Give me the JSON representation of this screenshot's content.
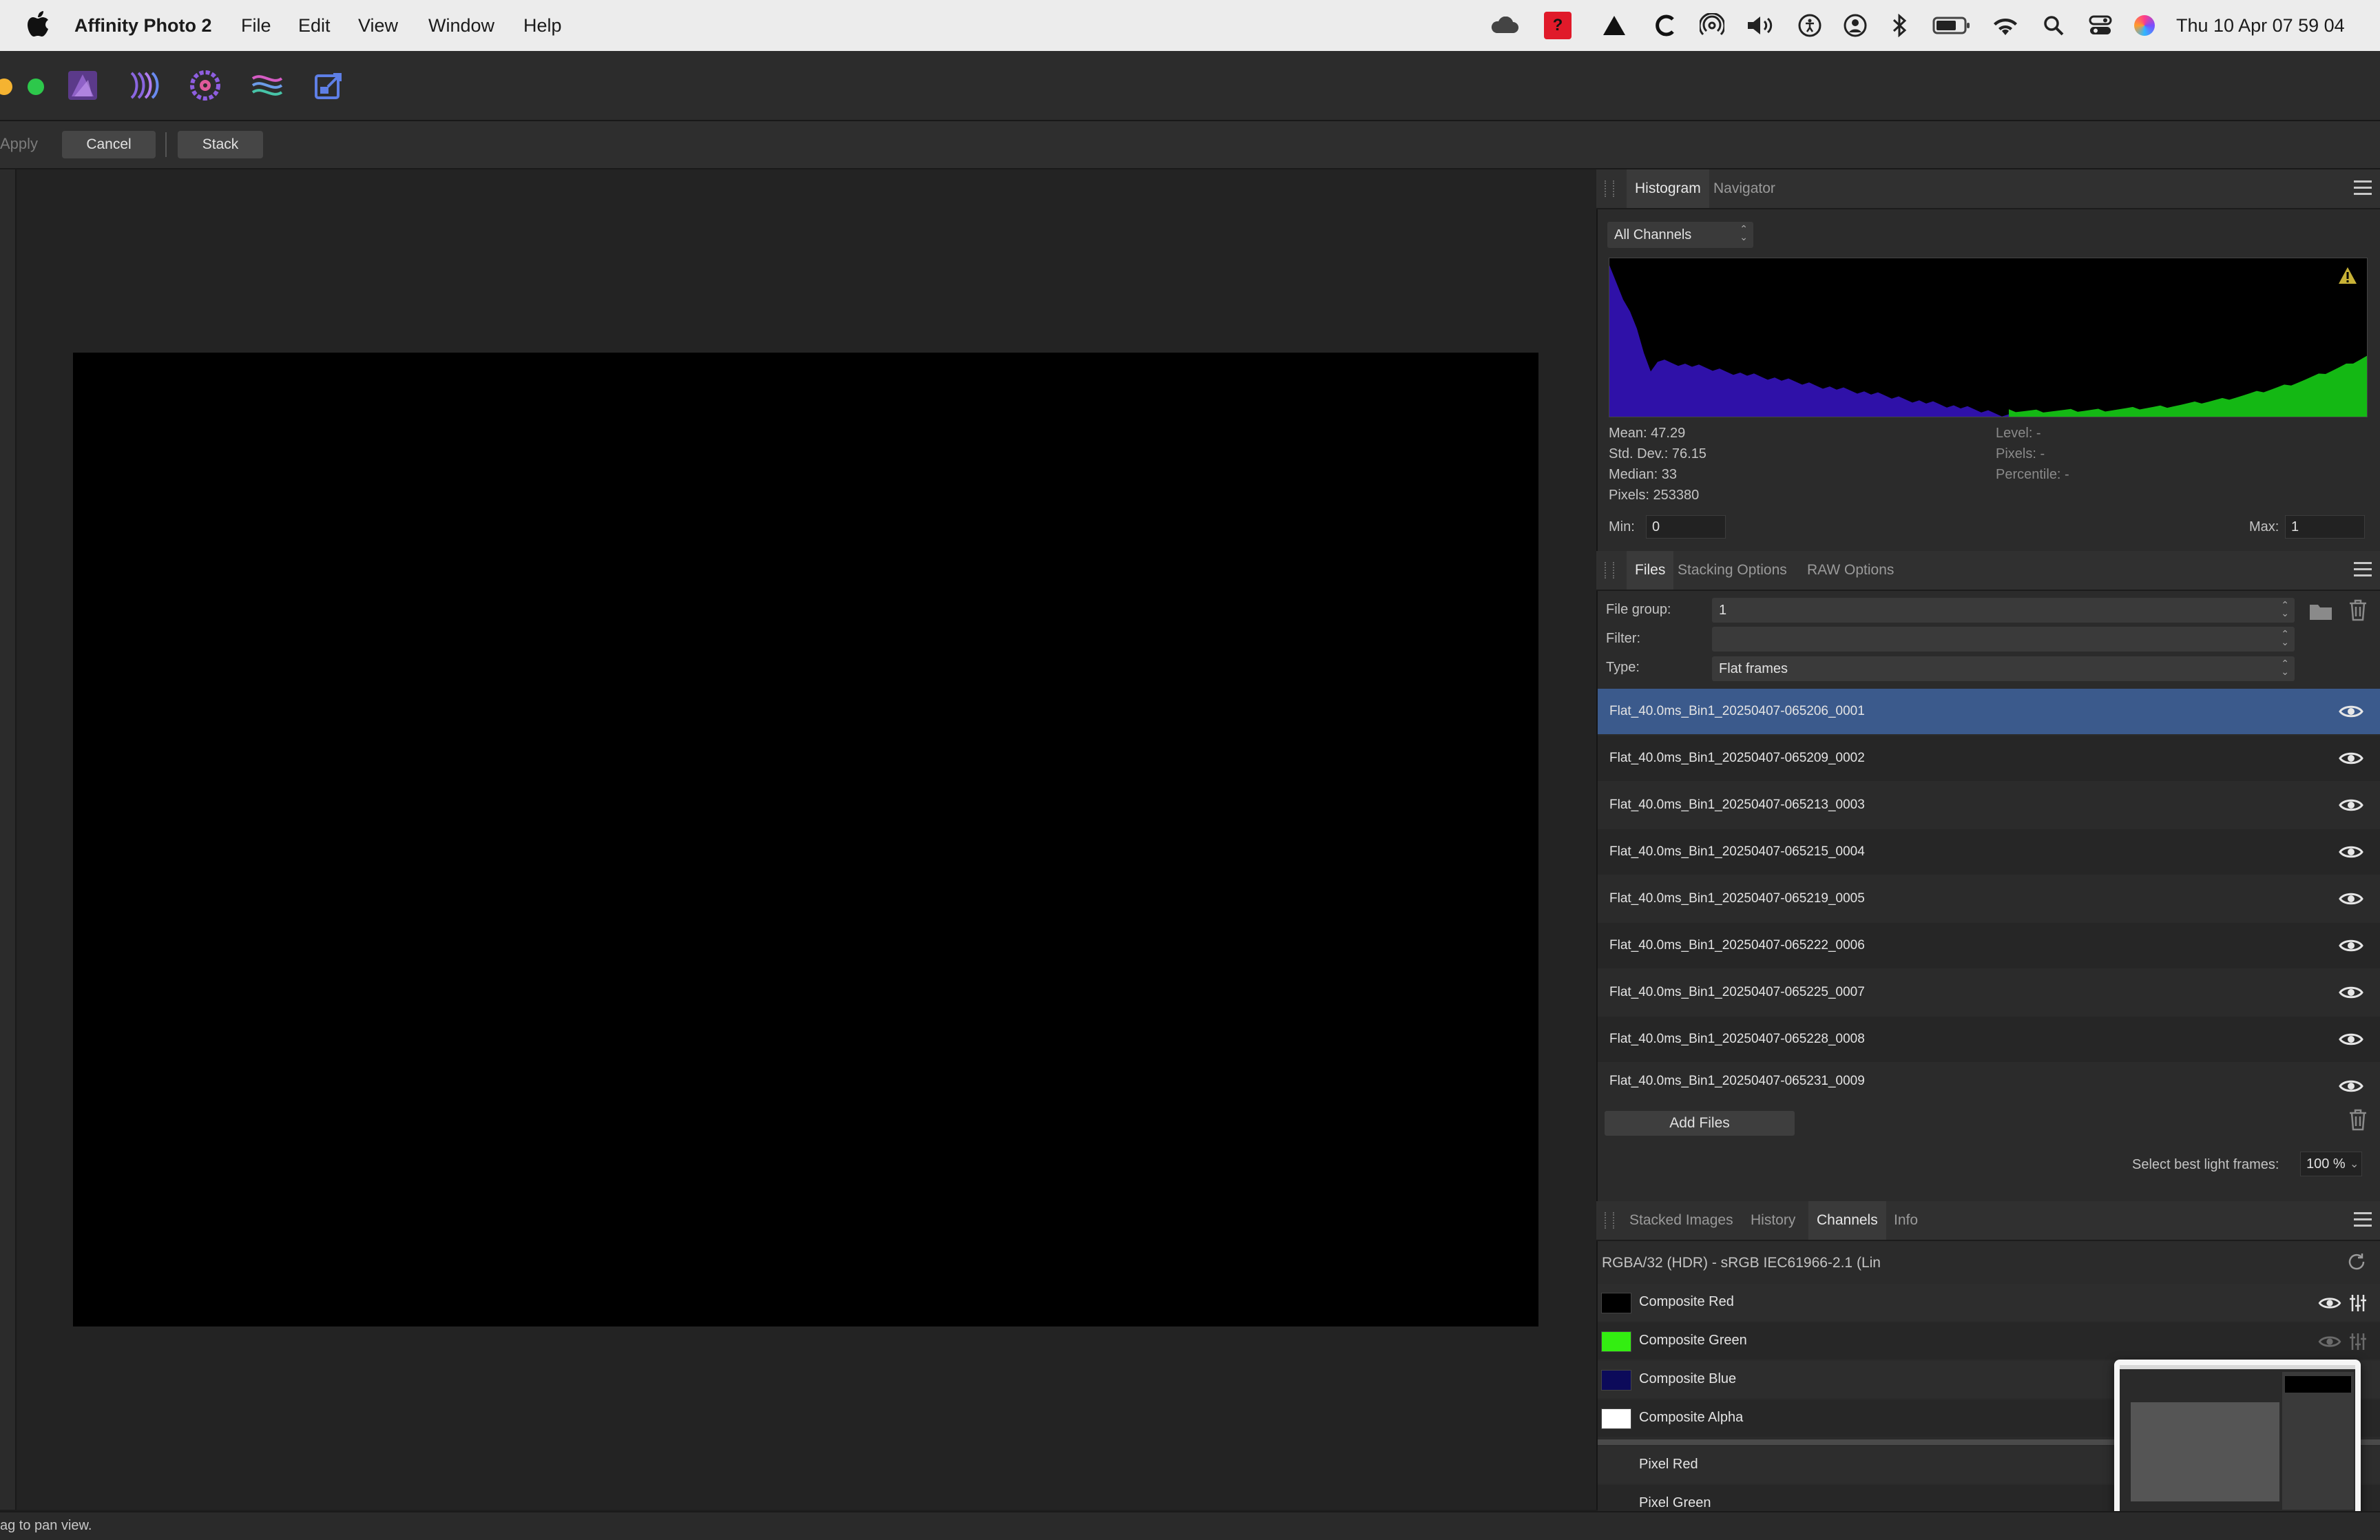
{
  "menubar": {
    "app_name": "Affinity Photo 2",
    "menus": [
      "File",
      "Edit",
      "View",
      "Window",
      "Help"
    ],
    "tray_icons": [
      "cloud-icon",
      "app-red-icon",
      "delta-icon",
      "c-icon",
      "airdrop-icon",
      "volume-icon",
      "accessibility-icon",
      "user-icon",
      "bluetooth-icon",
      "battery-icon",
      "wifi-icon",
      "spotlight-icon",
      "control-center-icon",
      "siri-icon"
    ],
    "clock": "Thu 10 Apr  07 59 04"
  },
  "toolbar": {
    "personas": [
      "photo-persona-icon",
      "liquify-persona-icon",
      "develop-persona-icon",
      "tone-mapping-persona-icon",
      "export-persona-icon"
    ]
  },
  "context_bar": {
    "apply_label": "Apply",
    "cancel_label": "Cancel",
    "stack_label": "Stack"
  },
  "status": {
    "text": "ag to pan view."
  },
  "histogram_panel": {
    "tabs": [
      "Histogram",
      "Navigator"
    ],
    "channel_select": "All Channels",
    "stats": {
      "mean": "Mean: 47.29",
      "std_dev": "Std. Dev.: 76.15",
      "median": "Median: 33",
      "pixels": "Pixels: 253380",
      "level": "Level: -",
      "pixels_sel": "Pixels: -",
      "percentile": "Percentile: -"
    },
    "min_label": "Min:",
    "min_value": "0",
    "max_label": "Max:",
    "max_value": "1",
    "colors": {
      "blue": "#2f11a8",
      "green": "#14b814"
    }
  },
  "files_panel": {
    "tabs": [
      "Files",
      "Stacking Options",
      "RAW Options"
    ],
    "file_group_label": "File group:",
    "file_group_value": "1",
    "filter_label": "Filter:",
    "filter_value": "",
    "type_label": "Type:",
    "type_value": "Flat frames",
    "files": [
      "Flat_40.0ms_Bin1_20250407-065206_0001",
      "Flat_40.0ms_Bin1_20250407-065209_0002",
      "Flat_40.0ms_Bin1_20250407-065213_0003",
      "Flat_40.0ms_Bin1_20250407-065215_0004",
      "Flat_40.0ms_Bin1_20250407-065219_0005",
      "Flat_40.0ms_Bin1_20250407-065222_0006",
      "Flat_40.0ms_Bin1_20250407-065225_0007",
      "Flat_40.0ms_Bin1_20250407-065228_0008",
      "Flat_40.0ms_Bin1_20250407-065231_0009"
    ],
    "add_files_label": "Add Files",
    "select_best_label": "Select best light frames:",
    "select_best_value": "100 %",
    "selected_color": "#3b5a8c"
  },
  "channels_panel": {
    "tabs": [
      "Stacked Images",
      "History",
      "Channels",
      "Info"
    ],
    "color_format": "RGBA/32 (HDR) - sRGB IEC61966-2.1 (Lin",
    "composite": [
      {
        "name": "Composite Red",
        "swatch": "#000000"
      },
      {
        "name": "Composite Green",
        "swatch": "#33ee11"
      },
      {
        "name": "Composite Blue",
        "swatch": "#0c0a5a"
      },
      {
        "name": "Composite Alpha",
        "swatch": "#ffffff"
      }
    ],
    "pixel": [
      "Pixel Red",
      "Pixel Green"
    ]
  }
}
